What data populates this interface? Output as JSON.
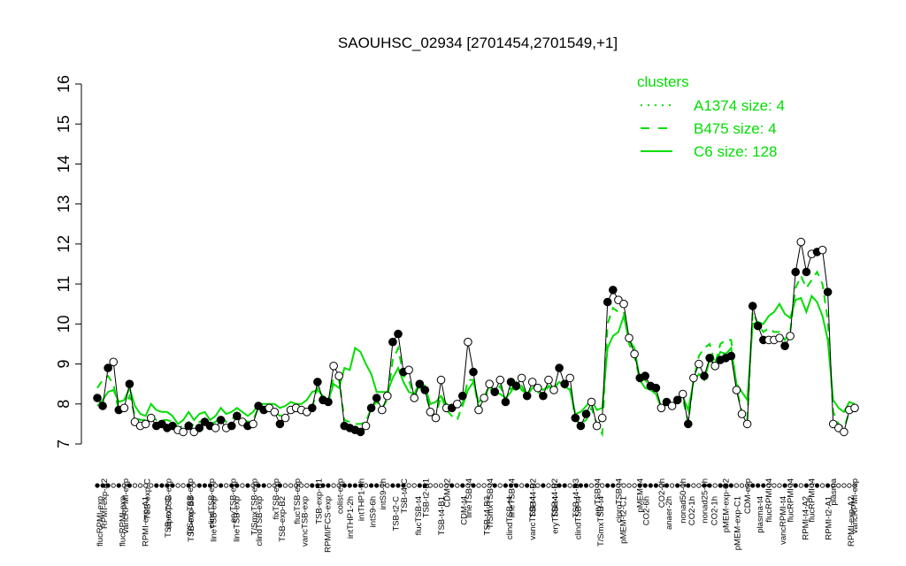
{
  "chart_data": {
    "type": "line",
    "title": "SAOUHSC_02934 [2701454,2701549,+1]",
    "ylim": [
      7,
      16
    ],
    "yticks": [
      "7",
      "8",
      "9",
      "10",
      "11",
      "12",
      "13",
      "14",
      "15",
      "16"
    ],
    "legend": {
      "title": "clusters",
      "placement": "top-right",
      "entries": [
        {
          "label": "A1374 size: 4",
          "style": "dotted"
        },
        {
          "label": "B475 size: 4",
          "style": "dashed"
        },
        {
          "label": "C6 size: 128",
          "style": "solid"
        }
      ]
    },
    "colors": {
      "cluster": "#00dd00",
      "points": "#000000",
      "axis": "#000000"
    },
    "x_labels_bottom": [
      "flucRPMI-exp",
      "flucRPMI-exp",
      "RPMI-exp-A1",
      "TSB-exp-C",
      "TSB-exp-B3",
      "lineTSB-exp",
      "lineTSB-exp",
      "clindTSB-exp",
      "TSB-exp-B2",
      "vancTSB-exp",
      "RPMI/FCS-exp",
      "intTHP1-2h",
      "intS9-6h",
      "TSB-t2-C",
      "flucTSB-t4",
      "TSB-t4-B1",
      "CDM-t4",
      "TSB-t4-B3",
      "clindTSB-t4",
      "vancTSB-t4",
      "eryTSB-t4",
      "clindTSB-t4",
      "T/SmxTSB-t4",
      "pMEM-t2-C1",
      "CO2-6h",
      "anaer-2h",
      "CO2-1h",
      "CO2-1h",
      "pMEM-exp-C1",
      "plasma-t4",
      "vancRPMI-t4",
      "RPMI-t4-A2",
      "RPMI-t2-A1",
      "RPMI-exp-A2"
    ],
    "x_labels_top": [
      "RPMI-exp-A2",
      "vancRPMI-exp",
      "TSB-exp-C",
      "ciproTSB-exp",
      "T/SmxTSB-exp",
      "clindTSB-exp",
      "eryTSB-exp",
      "T/SmxTSB-exp",
      "fixTSB-exp",
      "flucTSB-exp",
      "TSB-exp-B1",
      "colist-exp",
      "intTHP1-6h",
      "intS9-1h",
      "TSB-t4-C",
      "TSB-t2-B1",
      "CDM-t2",
      "lineTSB-t4",
      "T/SmxTSB-t4",
      "lineTSB-t4",
      "TSB-t4-B2",
      "TSB-t4-B2",
      "TSB-t4-B3",
      "eryTSB-t4",
      "ciproTSB-t4",
      "pMEM-t4",
      "CO2-2h",
      "nonad50-1h",
      "nonad25-1h",
      "pMEM-exp-C2",
      "CDM-exp",
      "flucRPMI-t4",
      "flucRPMI-t4",
      "flucRPMI-t4",
      "plasma",
      "vancRPMI-exp"
    ],
    "series": [
      {
        "style": "points",
        "values": [
          8.15,
          7.95,
          8.9,
          9.05,
          7.85,
          7.9,
          8.5,
          7.55,
          7.45,
          7.5,
          7.65,
          7.45,
          7.5,
          7.4,
          7.45,
          7.35,
          7.3,
          7.45,
          7.3,
          7.4,
          7.55,
          7.45,
          7.4,
          7.6,
          7.4,
          7.45,
          7.7,
          7.55,
          7.45,
          7.5,
          7.95,
          7.85,
          7.9,
          7.8,
          7.5,
          7.65,
          7.85,
          7.9,
          7.85,
          7.8,
          7.9,
          8.55,
          8.1,
          8.05,
          8.95,
          8.7,
          7.45,
          7.4,
          7.35,
          7.3,
          7.45,
          7.9,
          8.15,
          7.85,
          8.2,
          9.55,
          9.75,
          8.8,
          8.85,
          8.15,
          8.5,
          8.35,
          7.8,
          7.65,
          8.6,
          7.9,
          7.9,
          8.0,
          8.2,
          9.55,
          8.8,
          7.85,
          8.15,
          8.5,
          8.3,
          8.6,
          8.05,
          8.55,
          8.45,
          8.65,
          8.2,
          8.55,
          8.4,
          8.2,
          8.6,
          8.35,
          8.9,
          8.5,
          8.65,
          7.65,
          7.45,
          7.75,
          8.05,
          7.45,
          7.65,
          10.55,
          10.85,
          10.6,
          10.5,
          9.65,
          9.25,
          8.65,
          8.7,
          8.45,
          8.4,
          7.9,
          8.05,
          7.95,
          8.1,
          8.25,
          7.5,
          8.65,
          9.0,
          8.7,
          9.15,
          8.95,
          9.1,
          9.15,
          9.2,
          8.35,
          7.75,
          7.5,
          10.45,
          9.95,
          9.6,
          9.6,
          9.6,
          9.65,
          9.45,
          9.7,
          11.3,
          12.05,
          11.3,
          11.75,
          11.8,
          11.85,
          10.8,
          7.5,
          7.4,
          7.3,
          7.85,
          7.9
        ],
        "filled": [
          true,
          true,
          true,
          false,
          true,
          false,
          true,
          false,
          false,
          false,
          false,
          true,
          true,
          true,
          true,
          false,
          false,
          true,
          false,
          true,
          true,
          true,
          false,
          true,
          false,
          true,
          true,
          false,
          true,
          false,
          true,
          true,
          false,
          false,
          true,
          false,
          false,
          false,
          false,
          false,
          true,
          true,
          true,
          true,
          false,
          false,
          true,
          true,
          true,
          true,
          false,
          true,
          true,
          false,
          false,
          true,
          true,
          true,
          false,
          false,
          true,
          true,
          false,
          false,
          false,
          false,
          true,
          false,
          true,
          false,
          true,
          false,
          false,
          false,
          true,
          false,
          true,
          true,
          true,
          false,
          true,
          false,
          false,
          true,
          false,
          false,
          true,
          true,
          false,
          true,
          true,
          true,
          false,
          false,
          false,
          true,
          true,
          false,
          false,
          false,
          false,
          true,
          true,
          true,
          true,
          false,
          true,
          false,
          true,
          false,
          true,
          false,
          false,
          true,
          true,
          false,
          true,
          true,
          true,
          false,
          false,
          false,
          true,
          true,
          true,
          false,
          false,
          false,
          true,
          false,
          true,
          false,
          true,
          false,
          true,
          false,
          true,
          false,
          false,
          false,
          false,
          false,
          false
        ]
      },
      {
        "name": "C6 size: 128",
        "style": "solid",
        "values": [
          7.95,
          8.1,
          8.3,
          8.35,
          8.05,
          8.1,
          8.4,
          7.95,
          7.75,
          7.7,
          8.0,
          7.85,
          7.8,
          7.8,
          7.7,
          7.5,
          7.6,
          7.8,
          7.6,
          7.75,
          7.8,
          7.6,
          7.7,
          7.9,
          7.75,
          7.8,
          7.9,
          7.8,
          7.7,
          7.8,
          8.0,
          8.0,
          8.0,
          8.0,
          7.9,
          7.95,
          8.05,
          8.0,
          8.0,
          8.1,
          8.3,
          8.35,
          8.2,
          8.1,
          8.5,
          8.4,
          8.9,
          8.85,
          9.4,
          9.3,
          9.0,
          8.75,
          8.3,
          8.3,
          8.3,
          8.65,
          8.9,
          8.55,
          8.3,
          8.25,
          8.55,
          8.45,
          8.0,
          8.05,
          8.2,
          8.0,
          7.9,
          8.05,
          7.95,
          8.35,
          8.55,
          8.05,
          8.15,
          8.45,
          8.3,
          8.25,
          8.15,
          8.3,
          8.55,
          8.35,
          8.25,
          8.4,
          8.45,
          8.35,
          8.45,
          8.4,
          8.55,
          8.45,
          8.35,
          7.75,
          7.8,
          7.95,
          8.1,
          7.85,
          7.9,
          9.4,
          9.7,
          9.8,
          10.2,
          9.6,
          9.4,
          8.6,
          8.4,
          8.35,
          8.25,
          7.9,
          8.0,
          7.9,
          8.1,
          8.2,
          7.85,
          8.55,
          8.75,
          8.6,
          9.1,
          9.0,
          9.3,
          9.25,
          9.4,
          8.5,
          8.3,
          8.1,
          10.0,
          10.05,
          10.0,
          10.2,
          10.3,
          10.5,
          10.25,
          10.15,
          10.6,
          10.65,
          10.3,
          10.7,
          10.55,
          10.2,
          9.6,
          8.1,
          7.9,
          7.8,
          8.05,
          8.0
        ]
      },
      {
        "name": "B475 size: 4",
        "style": "dashed",
        "values": [
          8.4,
          8.6,
          8.7,
          8.5,
          7.8,
          7.9,
          8.2,
          7.7,
          7.6,
          7.6,
          7.7,
          7.6,
          7.6,
          7.6,
          7.55,
          7.4,
          7.45,
          7.55,
          7.45,
          7.55,
          7.6,
          7.5,
          7.55,
          7.7,
          7.55,
          7.6,
          7.75,
          7.65,
          7.55,
          7.6,
          7.9,
          7.85,
          7.85,
          7.8,
          7.7,
          7.75,
          7.9,
          7.9,
          7.85,
          7.85,
          7.9,
          8.4,
          8.1,
          8.0,
          8.7,
          8.6,
          7.6,
          7.55,
          7.5,
          7.5,
          7.55,
          7.9,
          8.05,
          7.9,
          8.1,
          9.1,
          9.4,
          8.7,
          8.6,
          8.15,
          8.4,
          8.3,
          7.85,
          7.7,
          8.2,
          7.85,
          7.7,
          7.6,
          8.0,
          8.6,
          8.6,
          7.9,
          8.1,
          8.4,
          8.25,
          8.45,
          8.1,
          8.4,
          8.35,
          8.45,
          8.2,
          8.4,
          8.3,
          8.2,
          8.45,
          8.3,
          8.6,
          8.4,
          8.45,
          7.6,
          7.5,
          7.6,
          7.9,
          7.5,
          7.25,
          10.0,
          10.4,
          10.3,
          10.3,
          9.5,
          9.2,
          8.6,
          8.6,
          8.4,
          8.35,
          7.9,
          8.0,
          7.9,
          8.05,
          8.15,
          7.55,
          8.6,
          9.2,
          9.4,
          9.5,
          9.0,
          9.5,
          9.6,
          9.6,
          8.4,
          7.8,
          7.6,
          10.3,
          10.0,
          9.8,
          9.9,
          9.8,
          9.8,
          9.6,
          9.8,
          10.9,
          11.2,
          10.9,
          11.1,
          11.3,
          11.0,
          10.1,
          7.8,
          7.5,
          7.4,
          7.8,
          7.9
        ]
      },
      {
        "name": "A1374 size: 4",
        "style": "dotted",
        "values": []
      }
    ]
  }
}
